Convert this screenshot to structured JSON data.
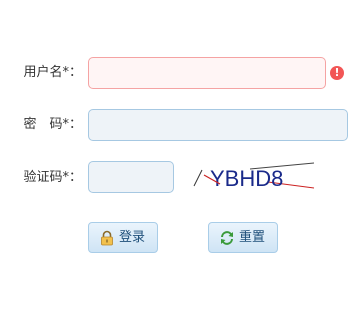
{
  "form": {
    "username": {
      "label": "用户名*：",
      "value": "",
      "error_mark": "!"
    },
    "password": {
      "label": "密　码*：",
      "value": ""
    },
    "captcha": {
      "label": "验证码*：",
      "value": "",
      "image_text": "YBHD8"
    }
  },
  "buttons": {
    "login_label": "登录",
    "reset_label": "重置"
  },
  "colors": {
    "error_red": "#f25656",
    "field_border": "#a6c8e2",
    "field_bg": "#eef3f8",
    "button_text": "#1e4f7a"
  },
  "icons": {
    "error": "exclamation-circle-icon",
    "login": "lock-icon",
    "reset": "refresh-icon"
  }
}
